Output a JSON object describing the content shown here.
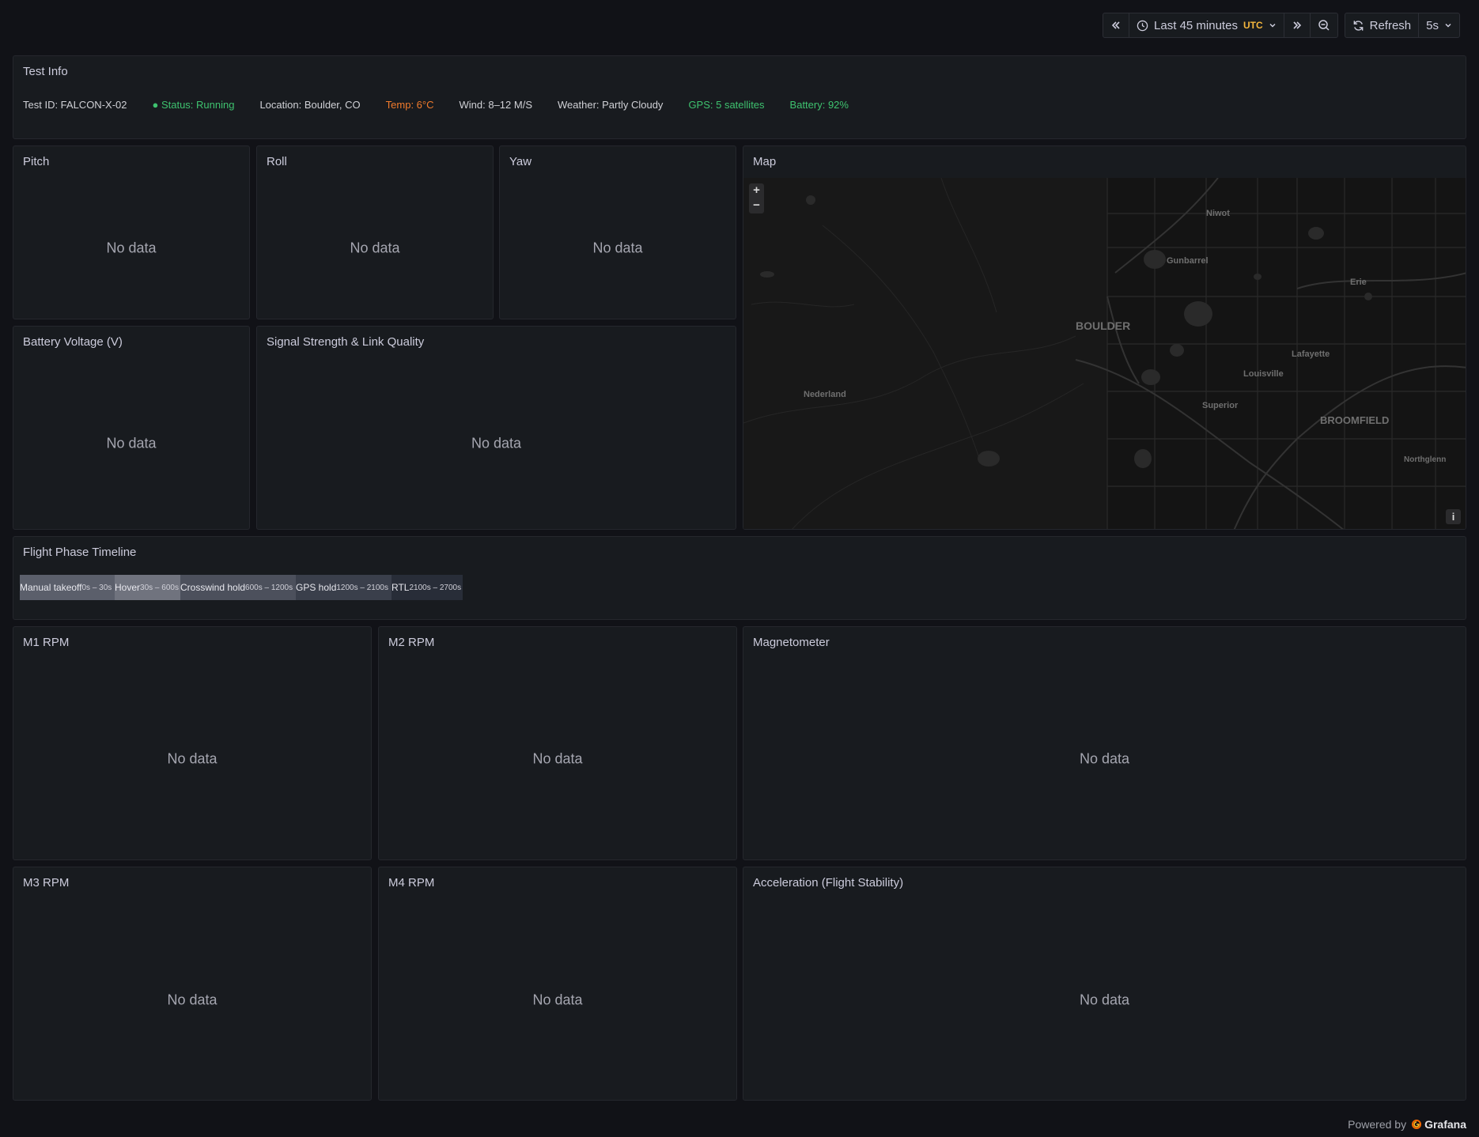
{
  "toolbar": {
    "time_range": "Last 45 minutes",
    "timezone": "UTC",
    "refresh_label": "Refresh",
    "refresh_interval": "5s"
  },
  "test_info": {
    "title": "Test Info",
    "items": [
      "Test ID: FALCON-X-02",
      "● Status: Running",
      "Location: Boulder, CO",
      "Temp: 6°C",
      "Wind: 8–12 M/S",
      "Weather: Partly Cloudy",
      "GPS: 5 satellites",
      "Battery: 92%"
    ]
  },
  "no_data": "No data",
  "panels": {
    "pitch": "Pitch",
    "roll": "Roll",
    "yaw": "Yaw",
    "map": "Map",
    "battery_voltage": "Battery Voltage (V)",
    "signal": "Signal Strength & Link Quality",
    "flight_phase": "Flight Phase Timeline",
    "m1": "M1 RPM",
    "m2": "M2 RPM",
    "magnetometer": "Magnetometer",
    "m3": "M3 RPM",
    "m4": "M4 RPM",
    "acceleration": "Acceleration (Flight Stability)"
  },
  "map": {
    "labels": [
      "Niwot",
      "Gunbarrel",
      "Erie",
      "BOULDER",
      "Lafayette",
      "Louisville",
      "Nederland",
      "Superior",
      "BROOMFIELD",
      "Northglenn"
    ],
    "zoom_in": "+",
    "zoom_out": "−",
    "info": "i"
  },
  "flight_phases": [
    {
      "name": "Manual takeoff",
      "range": "0s – 30s",
      "color": "#5b5f6b"
    },
    {
      "name": "Hover",
      "range": "30s – 600s",
      "color": "#70737e"
    },
    {
      "name": "Crosswind hold",
      "range": "600s – 1200s",
      "color": "#4c505c"
    },
    {
      "name": "GPS hold",
      "range": "1200s – 2100s",
      "color": "#3a3f4b"
    },
    {
      "name": "RTL",
      "range": "2100s – 2700s",
      "color": "#282d38"
    }
  ],
  "footer": {
    "powered_by": "Powered by",
    "brand": "Grafana"
  }
}
